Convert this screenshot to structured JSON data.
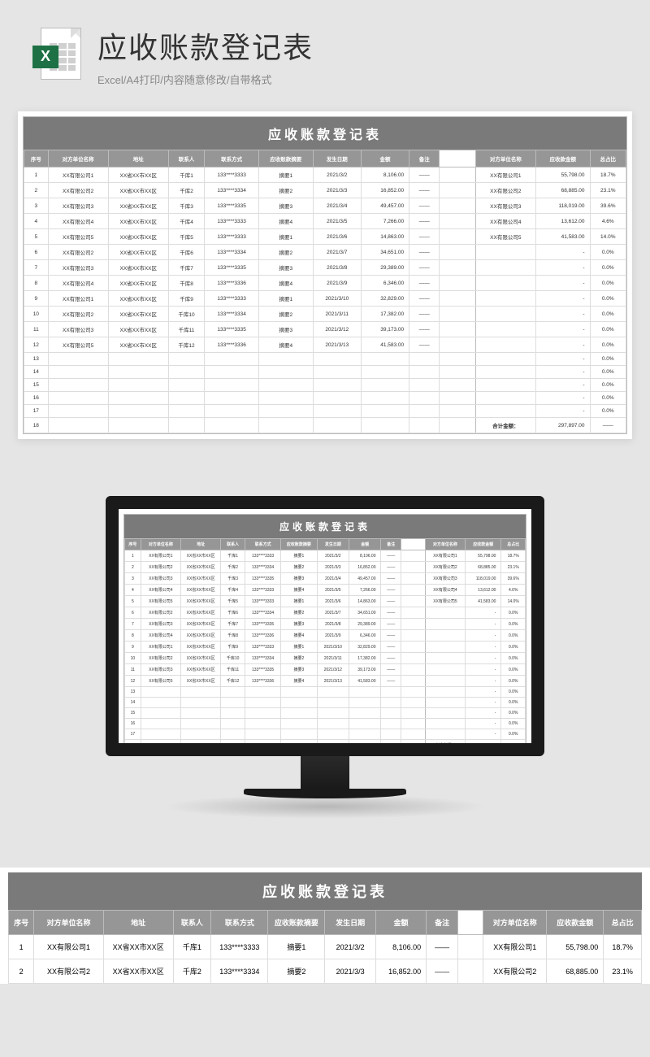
{
  "header": {
    "title": "应收账款登记表",
    "subtitle": "Excel/A4打印/内容随意修改/自带格式",
    "badge": "X"
  },
  "sheet": {
    "title": "应收账款登记表",
    "columns_left": [
      "序号",
      "对方单位名称",
      "地址",
      "联系人",
      "联系方式",
      "应收账款摘要",
      "发生日期",
      "金额",
      "备注"
    ],
    "columns_right": [
      "对方单位名称",
      "应收款金额",
      "总占比"
    ],
    "rows": [
      {
        "n": "1",
        "unit": "XX有限公司1",
        "addr": "XX省XX市XX区",
        "contact": "千库1",
        "phone": "133****3333",
        "summary": "摘要1",
        "date": "2021/3/2",
        "amount": "8,106.00",
        "note": "——",
        "r_unit": "XX有限公司1",
        "r_amt": "55,798.00",
        "r_pct": "18.7%"
      },
      {
        "n": "2",
        "unit": "XX有限公司2",
        "addr": "XX省XX市XX区",
        "contact": "千库2",
        "phone": "133****3334",
        "summary": "摘要2",
        "date": "2021/3/3",
        "amount": "16,852.00",
        "note": "——",
        "r_unit": "XX有限公司2",
        "r_amt": "68,885.00",
        "r_pct": "23.1%"
      },
      {
        "n": "3",
        "unit": "XX有限公司3",
        "addr": "XX省XX市XX区",
        "contact": "千库3",
        "phone": "133****3335",
        "summary": "摘要3",
        "date": "2021/3/4",
        "amount": "49,457.00",
        "note": "——",
        "r_unit": "XX有限公司3",
        "r_amt": "118,019.00",
        "r_pct": "39.6%"
      },
      {
        "n": "4",
        "unit": "XX有限公司4",
        "addr": "XX省XX市XX区",
        "contact": "千库4",
        "phone": "133****3333",
        "summary": "摘要4",
        "date": "2021/3/5",
        "amount": "7,266.00",
        "note": "——",
        "r_unit": "XX有限公司4",
        "r_amt": "13,612.00",
        "r_pct": "4.6%"
      },
      {
        "n": "5",
        "unit": "XX有限公司5",
        "addr": "XX省XX市XX区",
        "contact": "千库5",
        "phone": "133****3333",
        "summary": "摘要1",
        "date": "2021/3/6",
        "amount": "14,863.00",
        "note": "——",
        "r_unit": "XX有限公司5",
        "r_amt": "41,583.00",
        "r_pct": "14.0%"
      },
      {
        "n": "6",
        "unit": "XX有限公司2",
        "addr": "XX省XX市XX区",
        "contact": "千库6",
        "phone": "133****3334",
        "summary": "摘要2",
        "date": "2021/3/7",
        "amount": "34,651.00",
        "note": "——",
        "r_unit": "",
        "r_amt": "-",
        "r_pct": "0.0%"
      },
      {
        "n": "7",
        "unit": "XX有限公司3",
        "addr": "XX省XX市XX区",
        "contact": "千库7",
        "phone": "133****3335",
        "summary": "摘要3",
        "date": "2021/3/8",
        "amount": "29,389.00",
        "note": "——",
        "r_unit": "",
        "r_amt": "-",
        "r_pct": "0.0%"
      },
      {
        "n": "8",
        "unit": "XX有限公司4",
        "addr": "XX省XX市XX区",
        "contact": "千库8",
        "phone": "133****3336",
        "summary": "摘要4",
        "date": "2021/3/9",
        "amount": "6,346.00",
        "note": "——",
        "r_unit": "",
        "r_amt": "-",
        "r_pct": "0.0%"
      },
      {
        "n": "9",
        "unit": "XX有限公司1",
        "addr": "XX省XX市XX区",
        "contact": "千库9",
        "phone": "133****3333",
        "summary": "摘要1",
        "date": "2021/3/10",
        "amount": "32,829.00",
        "note": "——",
        "r_unit": "",
        "r_amt": "-",
        "r_pct": "0.0%"
      },
      {
        "n": "10",
        "unit": "XX有限公司2",
        "addr": "XX省XX市XX区",
        "contact": "千库10",
        "phone": "133****3334",
        "summary": "摘要2",
        "date": "2021/3/11",
        "amount": "17,382.00",
        "note": "——",
        "r_unit": "",
        "r_amt": "-",
        "r_pct": "0.0%"
      },
      {
        "n": "11",
        "unit": "XX有限公司3",
        "addr": "XX省XX市XX区",
        "contact": "千库11",
        "phone": "133****3335",
        "summary": "摘要3",
        "date": "2021/3/12",
        "amount": "39,173.00",
        "note": "——",
        "r_unit": "",
        "r_amt": "-",
        "r_pct": "0.0%"
      },
      {
        "n": "12",
        "unit": "XX有限公司5",
        "addr": "XX省XX市XX区",
        "contact": "千库12",
        "phone": "133****3336",
        "summary": "摘要4",
        "date": "2021/3/13",
        "amount": "41,583.00",
        "note": "——",
        "r_unit": "",
        "r_amt": "-",
        "r_pct": "0.0%"
      },
      {
        "n": "13",
        "unit": "",
        "addr": "",
        "contact": "",
        "phone": "",
        "summary": "",
        "date": "",
        "amount": "",
        "note": "",
        "r_unit": "",
        "r_amt": "-",
        "r_pct": "0.0%"
      },
      {
        "n": "14",
        "unit": "",
        "addr": "",
        "contact": "",
        "phone": "",
        "summary": "",
        "date": "",
        "amount": "",
        "note": "",
        "r_unit": "",
        "r_amt": "-",
        "r_pct": "0.0%"
      },
      {
        "n": "15",
        "unit": "",
        "addr": "",
        "contact": "",
        "phone": "",
        "summary": "",
        "date": "",
        "amount": "",
        "note": "",
        "r_unit": "",
        "r_amt": "-",
        "r_pct": "0.0%"
      },
      {
        "n": "16",
        "unit": "",
        "addr": "",
        "contact": "",
        "phone": "",
        "summary": "",
        "date": "",
        "amount": "",
        "note": "",
        "r_unit": "",
        "r_amt": "-",
        "r_pct": "0.0%"
      },
      {
        "n": "17",
        "unit": "",
        "addr": "",
        "contact": "",
        "phone": "",
        "summary": "",
        "date": "",
        "amount": "",
        "note": "",
        "r_unit": "",
        "r_amt": "-",
        "r_pct": "0.0%"
      }
    ],
    "footer": {
      "n": "18",
      "label": "合计金额：",
      "total": "297,897.00",
      "note": "——"
    }
  }
}
